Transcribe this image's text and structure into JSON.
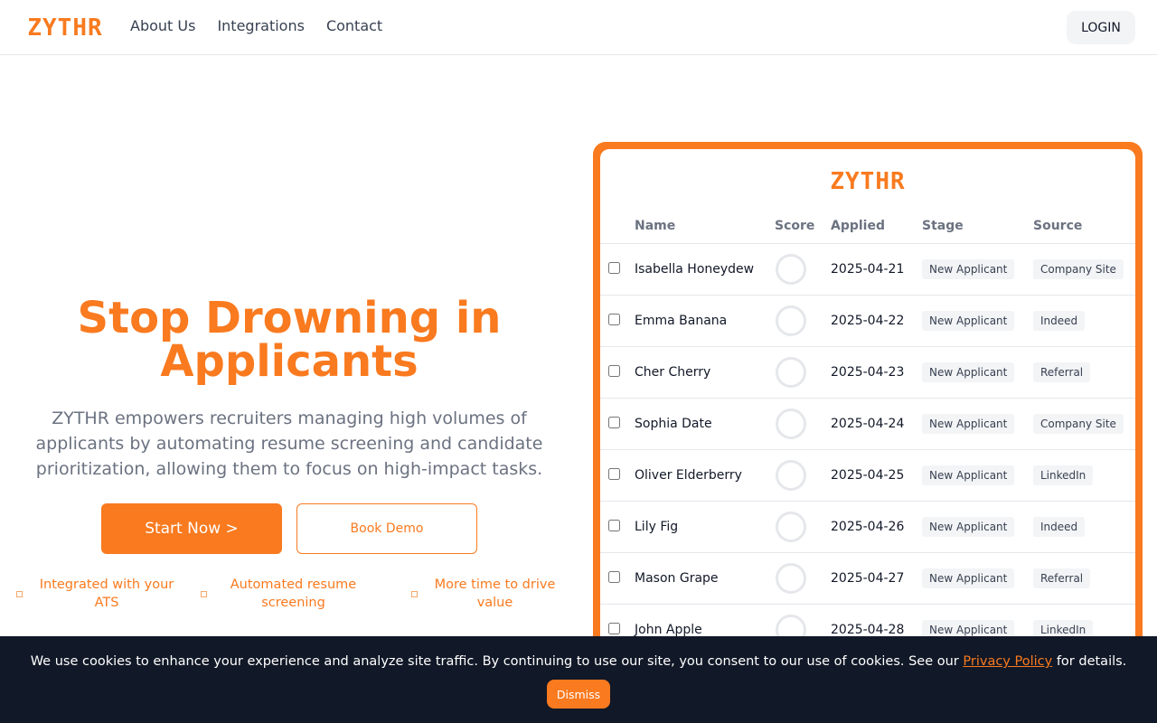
{
  "brand": {
    "name": "ZYTHR",
    "color": "#f97a1f"
  },
  "header": {
    "nav": [
      {
        "label": "About Us"
      },
      {
        "label": "Integrations"
      },
      {
        "label": "Contact"
      }
    ],
    "login_label": "LOGIN"
  },
  "hero": {
    "title": "Stop Drowning in Applicants",
    "subtitle": "ZYTHR empowers recruiters managing high volumes of applicants by automating resume screening and candidate prioritization, allowing them to focus on high-impact tasks.",
    "start_label": "Start Now >",
    "demo_label": "Book Demo",
    "features": [
      {
        "line1": "Integrated with your",
        "line2": "ATS"
      },
      {
        "line1": "Automated resume",
        "line2": "screening"
      },
      {
        "line1": "More time to drive",
        "line2": "value"
      }
    ]
  },
  "dashboard": {
    "columns": [
      "Name",
      "Score",
      "Applied",
      "Stage",
      "Source"
    ],
    "rows": [
      {
        "name": "Isabella Honeydew",
        "applied": "2025-04-21",
        "stage": "New Applicant",
        "source": "Company Site"
      },
      {
        "name": "Emma Banana",
        "applied": "2025-04-22",
        "stage": "New Applicant",
        "source": "Indeed"
      },
      {
        "name": "Cher Cherry",
        "applied": "2025-04-23",
        "stage": "New Applicant",
        "source": "Referral"
      },
      {
        "name": "Sophia Date",
        "applied": "2025-04-24",
        "stage": "New Applicant",
        "source": "Company Site"
      },
      {
        "name": "Oliver Elderberry",
        "applied": "2025-04-25",
        "stage": "New Applicant",
        "source": "LinkedIn"
      },
      {
        "name": "Lily Fig",
        "applied": "2025-04-26",
        "stage": "New Applicant",
        "source": "Indeed"
      },
      {
        "name": "Mason Grape",
        "applied": "2025-04-27",
        "stage": "New Applicant",
        "source": "Referral"
      },
      {
        "name": "John Apple",
        "applied": "2025-04-28",
        "stage": "New Applicant",
        "source": "LinkedIn"
      }
    ]
  },
  "cookie": {
    "text_before": "We use cookies to enhance your experience and analyze site traffic. By continuing to use our site, you consent to our use of cookies. See our ",
    "link_label": "Privacy Policy",
    "text_after": " for details.",
    "dismiss_label": "Dismiss"
  }
}
